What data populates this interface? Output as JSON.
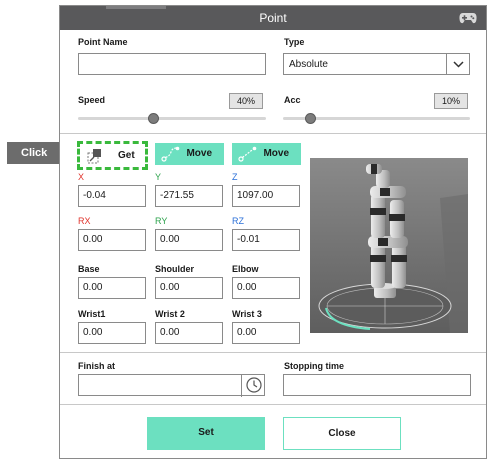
{
  "dialog": {
    "title": "Point"
  },
  "callout": {
    "label": "Click"
  },
  "point_name": {
    "label": "Point Name",
    "value": ""
  },
  "type": {
    "label": "Type",
    "value": "Absolute"
  },
  "speed": {
    "label": "Speed",
    "value": "40%",
    "level_percent": 40
  },
  "acc": {
    "label": "Acc",
    "value": "10%",
    "level_percent": 10
  },
  "buttons": {
    "get": "Get",
    "move1": "Move",
    "move2": "Move",
    "set": "Set",
    "close": "Close"
  },
  "coords": {
    "x": {
      "label": "X",
      "value": "-0.04"
    },
    "y": {
      "label": "Y",
      "value": "-271.55"
    },
    "z": {
      "label": "Z",
      "value": "1097.00"
    },
    "rx": {
      "label": "RX",
      "value": "0.00"
    },
    "ry": {
      "label": "RY",
      "value": "0.00"
    },
    "rz": {
      "label": "RZ",
      "value": "-0.01"
    }
  },
  "joints": {
    "base": {
      "label": "Base",
      "value": "0.00"
    },
    "shoulder": {
      "label": "Shoulder",
      "value": "0.00"
    },
    "elbow": {
      "label": "Elbow",
      "value": "0.00"
    },
    "wrist1": {
      "label": "Wrist1",
      "value": "0.00"
    },
    "wrist2": {
      "label": "Wrist 2",
      "value": "0.00"
    },
    "wrist3": {
      "label": "Wrist 3",
      "value": "0.00"
    }
  },
  "finish_at": {
    "label": "Finish at",
    "value": ""
  },
  "stopping_time": {
    "label": "Stopping time",
    "value": ""
  },
  "colors": {
    "accent": "#6ce0c0",
    "highlight": "#39b93c",
    "titlebar": "#59595b",
    "x_axis": "#e0322b",
    "y_axis": "#2aa24a",
    "z_axis": "#2a6fd8"
  },
  "icons": [
    "gamepad-icon",
    "get-pose-icon",
    "move-path-icon",
    "chevron-down-icon",
    "clock-icon"
  ]
}
